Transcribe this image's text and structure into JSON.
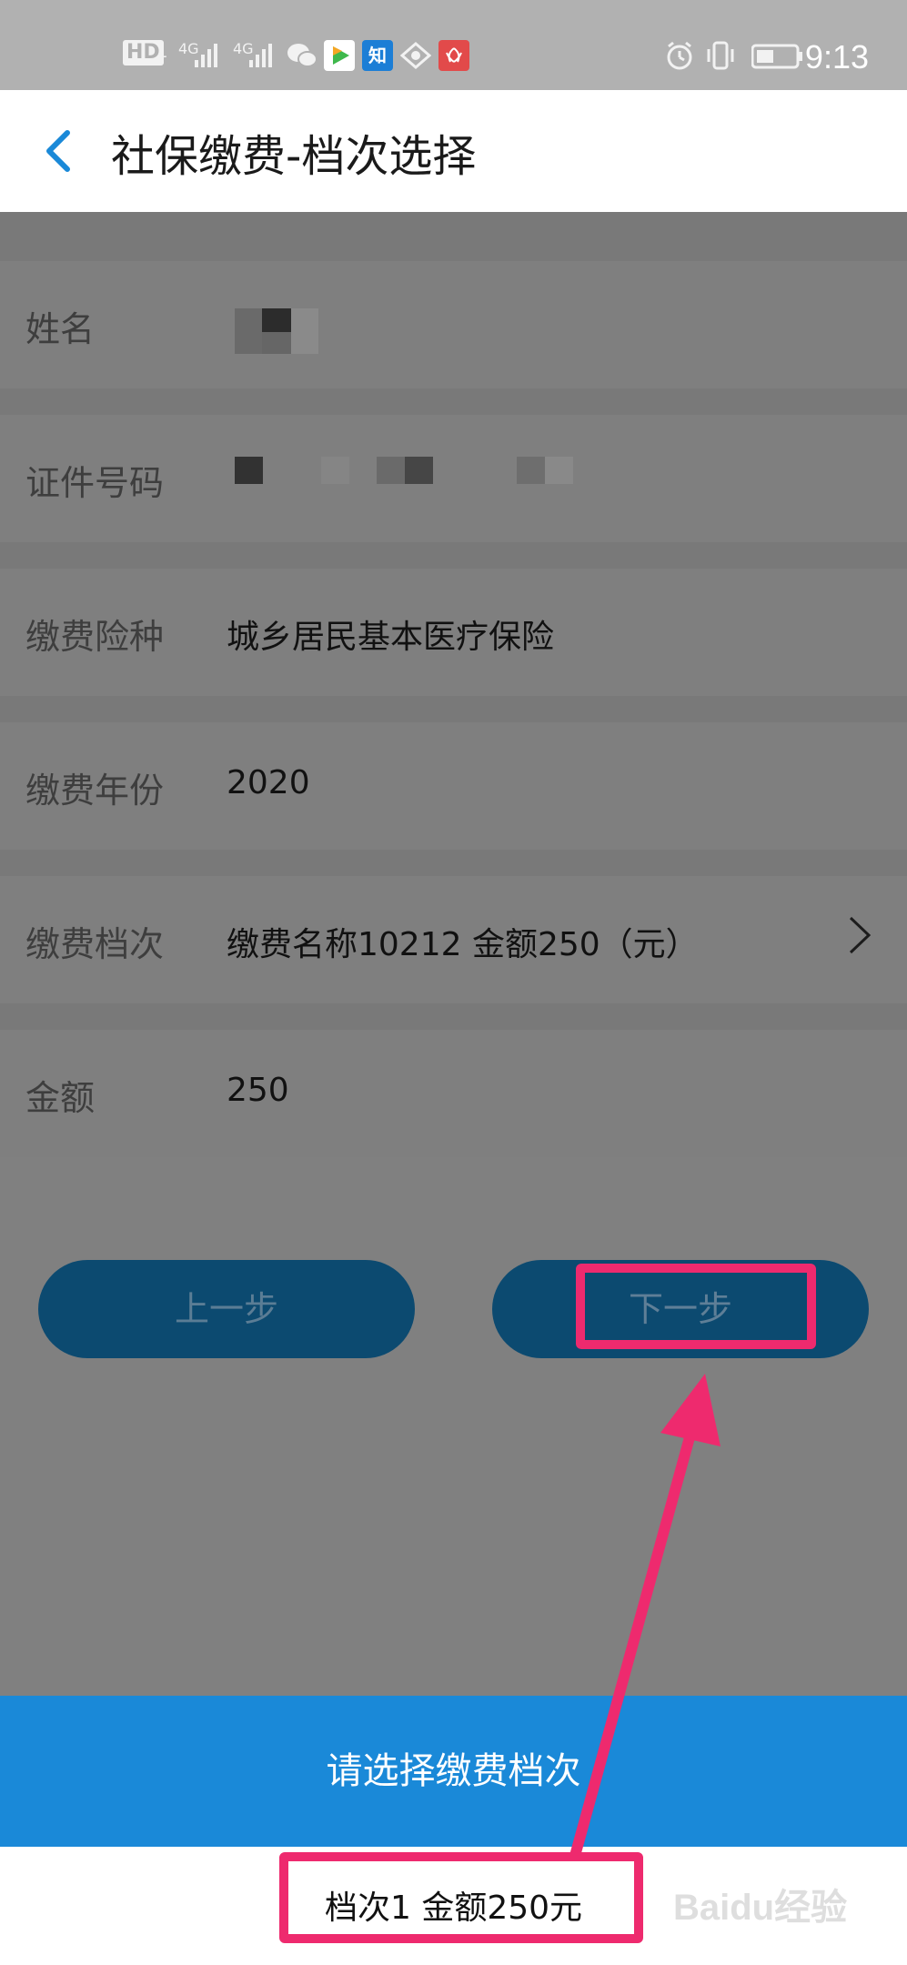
{
  "status_bar": {
    "hd": "HD",
    "sim": "1",
    "net1": "4G",
    "net2": "4G",
    "zhi": "知",
    "time": "9:13"
  },
  "header": {
    "title": "社保缴费-档次选择"
  },
  "form": {
    "rows": [
      {
        "label": "姓名",
        "value": ""
      },
      {
        "label": "证件号码",
        "value": ""
      },
      {
        "label": "缴费险种",
        "value": "城乡居民基本医疗保险"
      },
      {
        "label": "缴费年份",
        "value": "2020"
      },
      {
        "label": "缴费档次",
        "value": "缴费名称10212 金额250（元）"
      },
      {
        "label": "金额",
        "value": "250"
      }
    ]
  },
  "buttons": {
    "prev": "上一步",
    "next": "下一步"
  },
  "sheet": {
    "title": "请选择缴费档次",
    "option": "档次1  金额250元"
  },
  "watermark": "Baidu经验",
  "colors": {
    "primary": "#1a89d8",
    "button": "#0c4a70",
    "highlight": "#ee2a6e"
  }
}
